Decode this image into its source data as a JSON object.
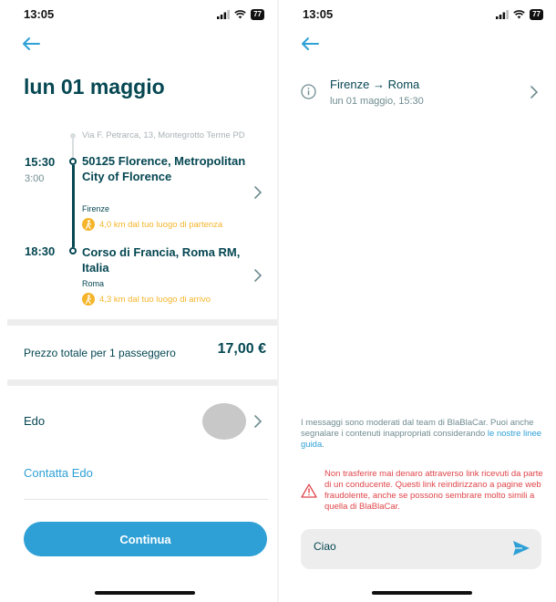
{
  "status": {
    "time": "13:05",
    "battery": "77"
  },
  "left": {
    "title": "lun 01 maggio",
    "pickup_address": "Via F. Petrarca, 13, Montegrotto Terme PD",
    "departure": {
      "time": "15:30",
      "duration": "3:00",
      "place": "50125 Florence, Metropolitan City of Florence",
      "city": "Firenze",
      "walk": "4,0 km dal tuo luogo di partenza"
    },
    "arrival": {
      "time": "18:30",
      "place": "Corso di Francia, Roma RM, Italia",
      "city": "Roma",
      "walk": "4,3 km dal tuo luogo di arrivo"
    },
    "price_label": "Prezzo totale per 1 passeggero",
    "price": "17,00 €",
    "driver_name": "Edo",
    "contact_label": "Contatta Edo",
    "continue_label": "Continua"
  },
  "right": {
    "route": "Firenze → Roma",
    "route_date": "lun 01 maggio, 15:30",
    "moderation_text": "I messaggi sono moderati dal team di BlaBlaCar. Puoi anche segnalare i contenuti inappropriati considerando ",
    "moderation_link": "le nostre linee guida",
    "moderation_end": ".",
    "warning_text": "Non trasferire mai denaro attraverso link ricevuti da parte di un conducente. Questi link reindirizzano a pagine web fraudolente, anche se possono sembrare molto simili a quella di BlaBlaCar.",
    "message_value": "Ciao"
  },
  "colors": {
    "accent": "#2ea0d6",
    "text": "#054752",
    "warning": "#e0454a",
    "walk": "#f5b52b"
  },
  "icons": [
    "back-arrow-icon",
    "chevron-right-icon",
    "walk-icon",
    "info-icon",
    "warning-icon",
    "send-icon",
    "signal-icon",
    "wifi-icon",
    "battery-icon"
  ]
}
